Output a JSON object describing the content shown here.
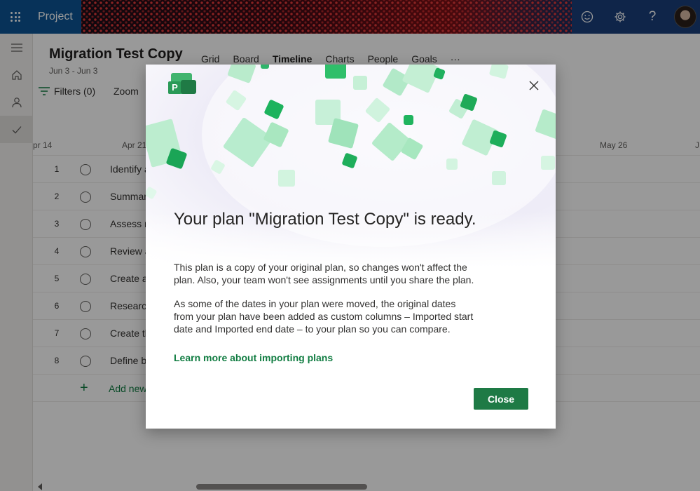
{
  "app": {
    "name": "Project"
  },
  "header": {
    "plan_title": "Migration Test Copy",
    "plan_dates": "Jun 3 - Jun 3",
    "tabs": [
      {
        "label": "Grid",
        "active": false
      },
      {
        "label": "Board",
        "active": false
      },
      {
        "label": "Timeline",
        "active": true
      },
      {
        "label": "Charts",
        "active": false
      },
      {
        "label": "People",
        "active": false
      },
      {
        "label": "Goals",
        "active": false
      },
      {
        "label": "···",
        "active": false
      }
    ],
    "filters_label": "Filters (0)",
    "zoom_label": "Zoom"
  },
  "timeline": {
    "date_headers": [
      "pr 14",
      "Apr 21",
      "May 26",
      "J"
    ],
    "tasks": [
      {
        "num": "1",
        "name": "Identify a"
      },
      {
        "num": "2",
        "name": "Summar"
      },
      {
        "num": "3",
        "name": "Assess m"
      },
      {
        "num": "4",
        "name": "Review a"
      },
      {
        "num": "5",
        "name": "Create ar"
      },
      {
        "num": "6",
        "name": "Research"
      },
      {
        "num": "7",
        "name": "Create th"
      },
      {
        "num": "8",
        "name": "Define b"
      }
    ],
    "add_new_label": "Add new"
  },
  "modal": {
    "title": "Your plan \"Migration Test Copy\" is ready.",
    "paragraph_1": "This plan is a copy of your original plan, so changes won't affect the plan. Also, your team won't see assignments until you share the plan.",
    "paragraph_2": "As some of the dates in your plan were moved, the original dates from your plan have been added as custom columns – Imported start date and Imported end date – to your plan so you can compare.",
    "learn_more": "Learn more about importing plans",
    "close_button": "Close",
    "logo_letter": "P"
  },
  "colors": {
    "accent_green": "#107c41",
    "button_green": "#1e7a45",
    "suite_bar": "#0c5494"
  },
  "icons": {
    "waffle": "app-launcher-icon",
    "feedback": "smiley-icon",
    "settings": "gear-icon",
    "help": "question-icon",
    "rail_menu": "hamburger-icon",
    "rail_home": "home-icon",
    "rail_person": "person-icon",
    "rail_tasks": "checkmark-icon",
    "filter": "filter-icon",
    "close": "close-icon"
  }
}
